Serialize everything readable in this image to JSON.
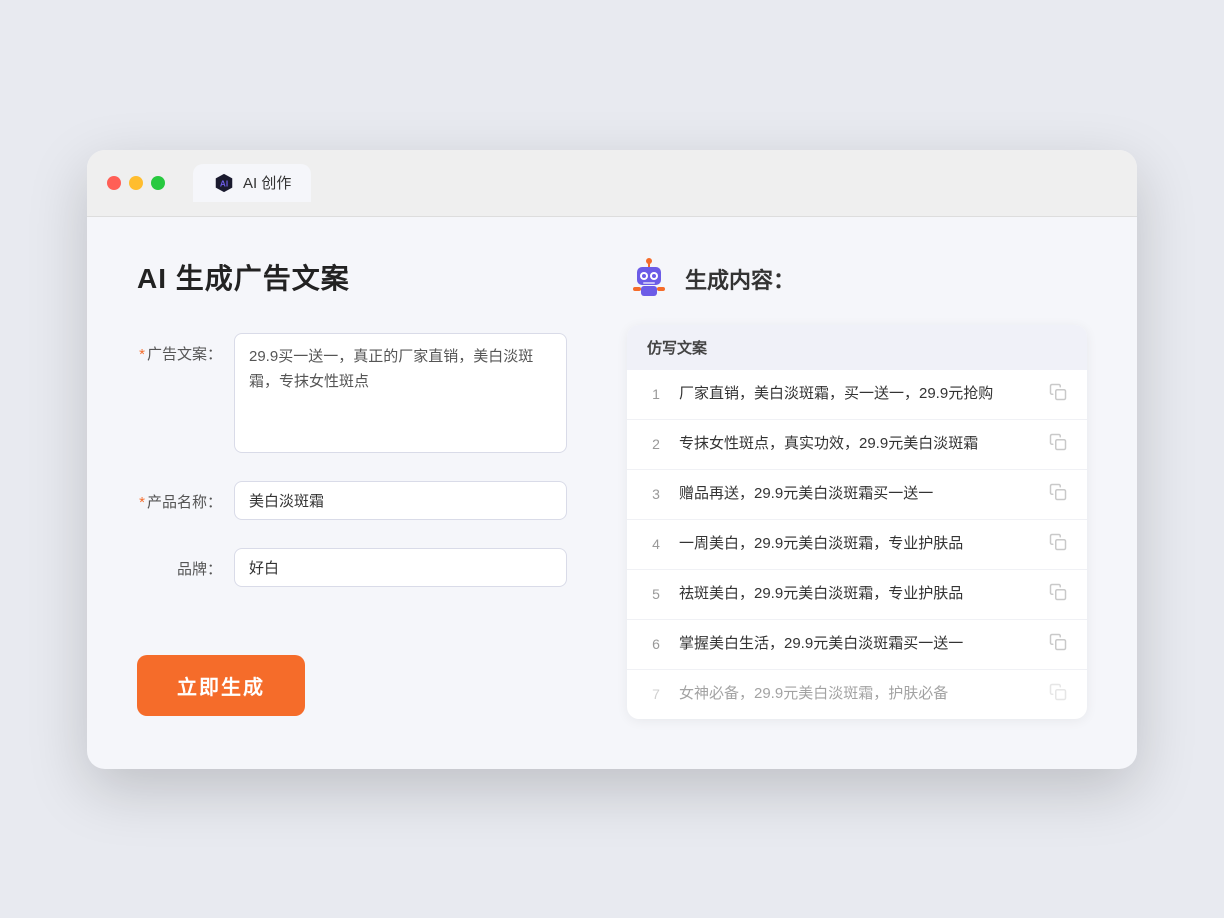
{
  "window": {
    "tab_label": "AI 创作"
  },
  "left": {
    "title": "AI 生成广告文案",
    "fields": {
      "ad_copy_label": "广告文案：",
      "ad_copy_value": "29.9买一送一，真正的厂家直销，美白淡斑霜，专抹女性斑点",
      "product_name_label": "产品名称：",
      "product_name_value": "美白淡斑霜",
      "brand_label": "品牌：",
      "brand_value": "好白"
    },
    "button_label": "立即生成"
  },
  "right": {
    "title": "生成内容：",
    "table_header": "仿写文案",
    "results": [
      {
        "id": 1,
        "text": "厂家直销，美白淡斑霜，买一送一，29.9元抢购",
        "faded": false
      },
      {
        "id": 2,
        "text": "专抹女性斑点，真实功效，29.9元美白淡斑霜",
        "faded": false
      },
      {
        "id": 3,
        "text": "赠品再送，29.9元美白淡斑霜买一送一",
        "faded": false
      },
      {
        "id": 4,
        "text": "一周美白，29.9元美白淡斑霜，专业护肤品",
        "faded": false
      },
      {
        "id": 5,
        "text": "祛斑美白，29.9元美白淡斑霜，专业护肤品",
        "faded": false
      },
      {
        "id": 6,
        "text": "掌握美白生活，29.9元美白淡斑霜买一送一",
        "faded": false
      },
      {
        "id": 7,
        "text": "女神必备，29.9元美白淡斑霜，护肤必备",
        "faded": true
      }
    ]
  }
}
